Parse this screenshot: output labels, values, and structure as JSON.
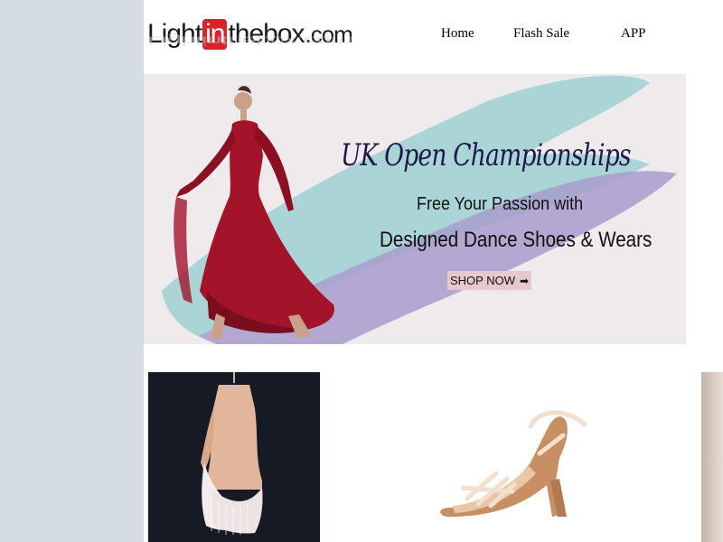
{
  "header": {
    "logo": {
      "part1": "Light",
      "part2": "in",
      "part3": "thebox",
      "part4": ".com"
    },
    "nav": [
      {
        "label": "Home"
      },
      {
        "label": "Flash Sale"
      },
      {
        "label": "APP"
      }
    ]
  },
  "banner": {
    "title": "UK Open Championships",
    "line1": "Free Your Passion with",
    "line2": "Designed Dance Shoes & Wears",
    "cta_label": "SHOP NOW",
    "cta_arrow": "➡",
    "colors": {
      "background": "#efeaec",
      "teal_brush": "#9fd0d2",
      "purple_brush": "#a79ccd",
      "dress": "#a3132a"
    }
  },
  "products": [
    {
      "name": "latin-dance-dress",
      "icon": "dress-image"
    },
    {
      "name": "dance-sandal-shoe",
      "icon": "shoe-image"
    },
    {
      "name": "third-product",
      "icon": "product-image"
    }
  ],
  "colors": {
    "page_bg": "#d4dce5",
    "content_bg": "#ffffff",
    "brand_red": "#d6242b"
  }
}
